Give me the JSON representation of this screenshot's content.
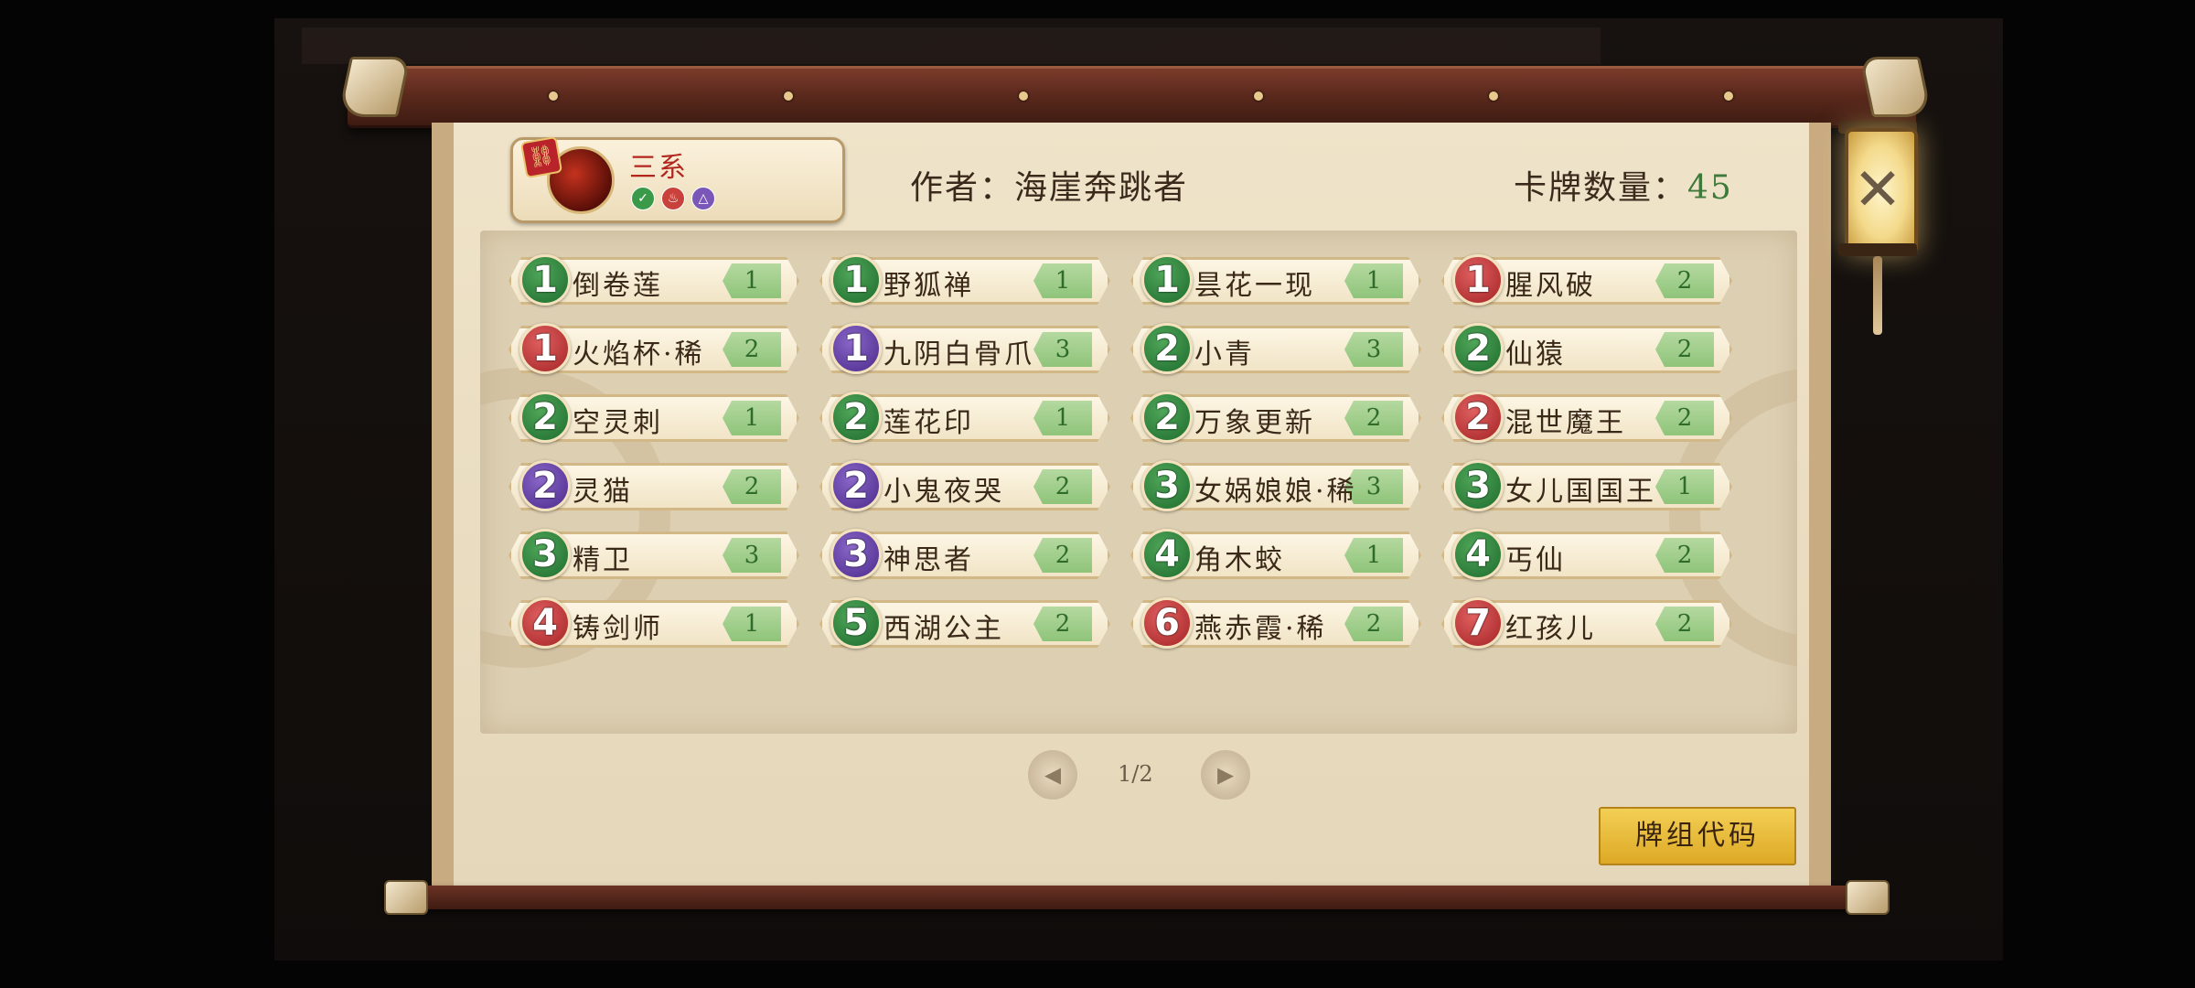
{
  "deck": {
    "name": "三系",
    "link_icon": "chain-link-icon",
    "elements": [
      {
        "icon": "wood-element-icon",
        "glyph": "✓",
        "color": "#3b9a4a"
      },
      {
        "icon": "fire-element-icon",
        "glyph": "♨",
        "color": "#c8413a"
      },
      {
        "icon": "mystic-element-icon",
        "glyph": "△",
        "color": "#7a56b8"
      }
    ],
    "author_label": "作者：",
    "author": "海崖奔跳者",
    "count_label": "卡牌数量：",
    "count": "45"
  },
  "colors": {
    "green": "#2f8a3f",
    "red": "#c23a36",
    "purple": "#5b3aa4",
    "accent_gold": "#e8bb3a"
  },
  "cards": [
    {
      "cost": "1",
      "color": "green",
      "name": "倒卷莲",
      "qty": "1"
    },
    {
      "cost": "1",
      "color": "green",
      "name": "野狐禅",
      "qty": "1"
    },
    {
      "cost": "1",
      "color": "green",
      "name": "昙花一现",
      "qty": "1"
    },
    {
      "cost": "1",
      "color": "red",
      "name": "腥风破",
      "qty": "2"
    },
    {
      "cost": "1",
      "color": "red",
      "name": "火焰杯·稀",
      "qty": "2"
    },
    {
      "cost": "1",
      "color": "purple",
      "name": "九阴白骨爪",
      "qty": "3"
    },
    {
      "cost": "2",
      "color": "green",
      "name": "小青",
      "qty": "3"
    },
    {
      "cost": "2",
      "color": "green",
      "name": "仙猿",
      "qty": "2"
    },
    {
      "cost": "2",
      "color": "green",
      "name": "空灵刺",
      "qty": "1"
    },
    {
      "cost": "2",
      "color": "green",
      "name": "莲花印",
      "qty": "1"
    },
    {
      "cost": "2",
      "color": "green",
      "name": "万象更新",
      "qty": "2"
    },
    {
      "cost": "2",
      "color": "red",
      "name": "混世魔王",
      "qty": "2"
    },
    {
      "cost": "2",
      "color": "purple",
      "name": "灵猫",
      "qty": "2"
    },
    {
      "cost": "2",
      "color": "purple",
      "name": "小鬼夜哭",
      "qty": "2"
    },
    {
      "cost": "3",
      "color": "green",
      "name": "女娲娘娘·稀",
      "qty": "3"
    },
    {
      "cost": "3",
      "color": "green",
      "name": "女儿国国王",
      "qty": "1"
    },
    {
      "cost": "3",
      "color": "green",
      "name": "精卫",
      "qty": "3"
    },
    {
      "cost": "3",
      "color": "purple",
      "name": "神思者",
      "qty": "2"
    },
    {
      "cost": "4",
      "color": "green",
      "name": "角木蛟",
      "qty": "1"
    },
    {
      "cost": "4",
      "color": "green",
      "name": "丐仙",
      "qty": "2"
    },
    {
      "cost": "4",
      "color": "red",
      "name": "铸剑师",
      "qty": "1"
    },
    {
      "cost": "5",
      "color": "green",
      "name": "西湖公主",
      "qty": "2"
    },
    {
      "cost": "6",
      "color": "red",
      "name": "燕赤霞·稀",
      "qty": "2"
    },
    {
      "cost": "7",
      "color": "red",
      "name": "红孩儿",
      "qty": "2"
    }
  ],
  "pagination": {
    "indicator": "1/2",
    "prev_icon": "swirl-left-arrow-icon",
    "next_icon": "swirl-right-arrow-icon"
  },
  "buttons": {
    "deck_code": "牌组代码",
    "close_icon": "close-x-icon"
  }
}
